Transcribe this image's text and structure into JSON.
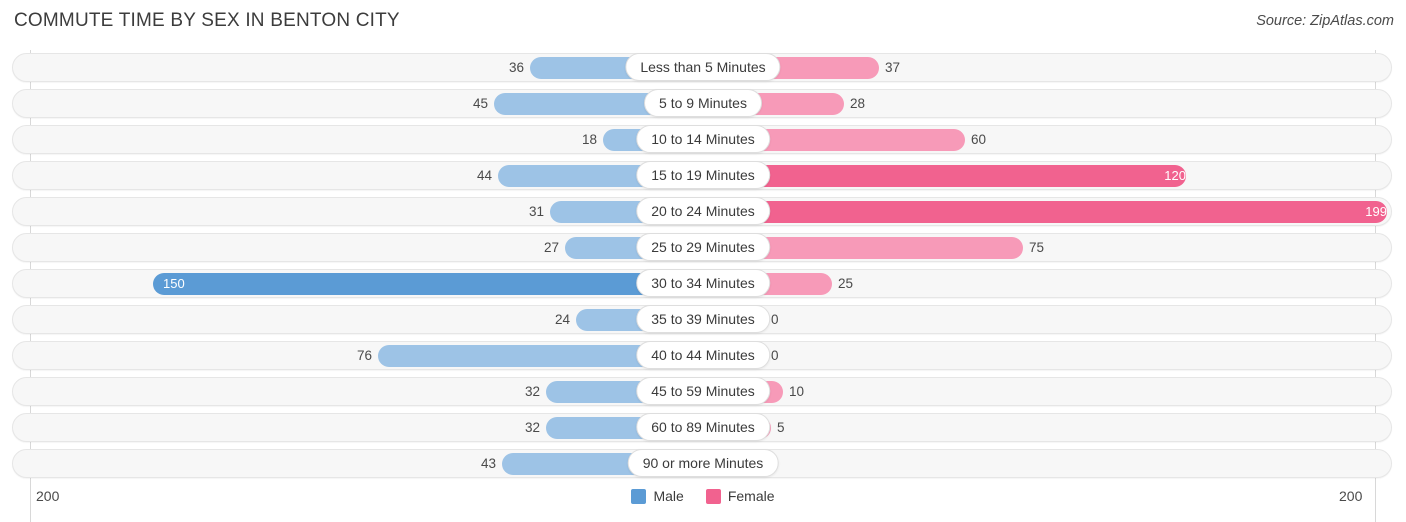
{
  "header": {
    "title": "COMMUTE TIME BY SEX IN BENTON CITY",
    "source": "Source: ZipAtlas.com"
  },
  "legend": {
    "items": [
      {
        "label": "Male",
        "color": "#5b9bd5"
      },
      {
        "label": "Female",
        "color": "#f1628f"
      }
    ]
  },
  "axis": {
    "left_max": "200",
    "right_max": "200"
  },
  "chart_data": {
    "type": "bar",
    "title": "COMMUTE TIME BY SEX IN BENTON CITY",
    "subtitle": "Source: ZipAtlas.com",
    "orientation": "horizontal-diverging",
    "xlabel": "",
    "ylabel": "",
    "xlim": [
      200,
      200
    ],
    "axis_max": 200,
    "grid": false,
    "legend_position": "bottom-center",
    "categories": [
      "Less than 5 Minutes",
      "5 to 9 Minutes",
      "10 to 14 Minutes",
      "15 to 19 Minutes",
      "20 to 24 Minutes",
      "25 to 29 Minutes",
      "30 to 34 Minutes",
      "35 to 39 Minutes",
      "40 to 44 Minutes",
      "45 to 59 Minutes",
      "60 to 89 Minutes",
      "90 or more Minutes"
    ],
    "series": [
      {
        "name": "Male",
        "side": "left",
        "color": "#9dc3e6",
        "highlight_color": "#5b9bd5",
        "values": [
          36,
          45,
          18,
          44,
          31,
          27,
          150,
          24,
          76,
          32,
          32,
          43
        ]
      },
      {
        "name": "Female",
        "side": "right",
        "color": "#f79ab8",
        "highlight_color": "#f1628f",
        "values": [
          37,
          28,
          60,
          120,
          199,
          75,
          25,
          0,
          0,
          10,
          5,
          0
        ]
      }
    ]
  },
  "rows": [
    {
      "label": "Less than 5 Minutes",
      "male": "36",
      "female": "37",
      "male_w": 173,
      "female_w": 176,
      "male_in": false,
      "female_in": false,
      "male_strong": false,
      "female_strong": false
    },
    {
      "label": "5 to 9 Minutes",
      "male": "45",
      "female": "28",
      "male_w": 209,
      "female_w": 141,
      "male_in": false,
      "female_in": false,
      "male_strong": false,
      "female_strong": false
    },
    {
      "label": "10 to 14 Minutes",
      "male": "18",
      "female": "60",
      "male_w": 100,
      "female_w": 262,
      "male_in": false,
      "female_in": false,
      "male_strong": false,
      "female_strong": false
    },
    {
      "label": "15 to 19 Minutes",
      "male": "44",
      "female": "120",
      "male_w": 205,
      "female_w": 483,
      "male_in": false,
      "female_in": true,
      "male_strong": false,
      "female_strong": true
    },
    {
      "label": "20 to 24 Minutes",
      "male": "31",
      "female": "199",
      "male_w": 153,
      "female_w": 684,
      "male_in": false,
      "female_in": true,
      "male_strong": false,
      "female_strong": true
    },
    {
      "label": "25 to 29 Minutes",
      "male": "27",
      "female": "75",
      "male_w": 138,
      "female_w": 320,
      "male_in": false,
      "female_in": false,
      "male_strong": false,
      "female_strong": false
    },
    {
      "label": "30 to 34 Minutes",
      "male": "150",
      "female": "25",
      "male_w": 550,
      "female_w": 129,
      "male_in": true,
      "female_in": false,
      "male_strong": true,
      "female_strong": false
    },
    {
      "label": "35 to 39 Minutes",
      "male": "24",
      "female": "0",
      "male_w": 127,
      "female_w": 62,
      "male_in": false,
      "female_in": false,
      "male_strong": false,
      "female_strong": false
    },
    {
      "label": "40 to 44 Minutes",
      "male": "76",
      "female": "0",
      "male_w": 325,
      "female_w": 62,
      "male_in": false,
      "female_in": false,
      "male_strong": false,
      "female_strong": false
    },
    {
      "label": "45 to 59 Minutes",
      "male": "32",
      "female": "10",
      "male_w": 157,
      "female_w": 80,
      "male_in": false,
      "female_in": false,
      "male_strong": false,
      "female_strong": false
    },
    {
      "label": "60 to 89 Minutes",
      "male": "32",
      "female": "5",
      "male_w": 157,
      "female_w": 68,
      "male_in": false,
      "female_in": false,
      "male_strong": false,
      "female_strong": false
    },
    {
      "label": "90 or more Minutes",
      "male": "43",
      "female": "0",
      "male_w": 201,
      "female_w": 62,
      "male_in": false,
      "female_in": false,
      "male_strong": false,
      "female_strong": false
    }
  ]
}
